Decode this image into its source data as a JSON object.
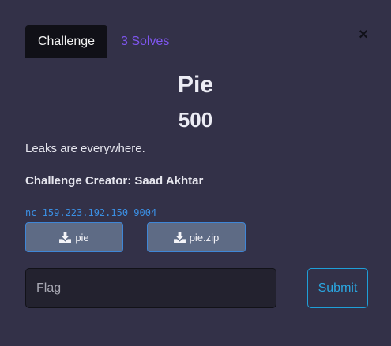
{
  "modal": {
    "close_label": "×"
  },
  "tabs": [
    {
      "label": "Challenge",
      "active": true
    },
    {
      "label": "3 Solves",
      "active": false
    }
  ],
  "challenge": {
    "name": "Pie",
    "points": "500",
    "description": "Leaks are everywhere.",
    "creator": "Challenge Creator: Saad Akhtar",
    "connection": "nc 159.223.192.150 9004"
  },
  "files": [
    {
      "label": "pie",
      "icon": "download-icon"
    },
    {
      "label": "pie.zip",
      "icon": "download-icon"
    }
  ],
  "flag_form": {
    "placeholder": "Flag",
    "value": "",
    "submit_label": "Submit"
  },
  "colors": {
    "background": "#333148",
    "active_tab": "#101017",
    "solves_link": "#7f56f0",
    "connection_text": "#3b8fe3",
    "file_button": "#5e6b85",
    "submit_accent": "#1f9fd8"
  }
}
